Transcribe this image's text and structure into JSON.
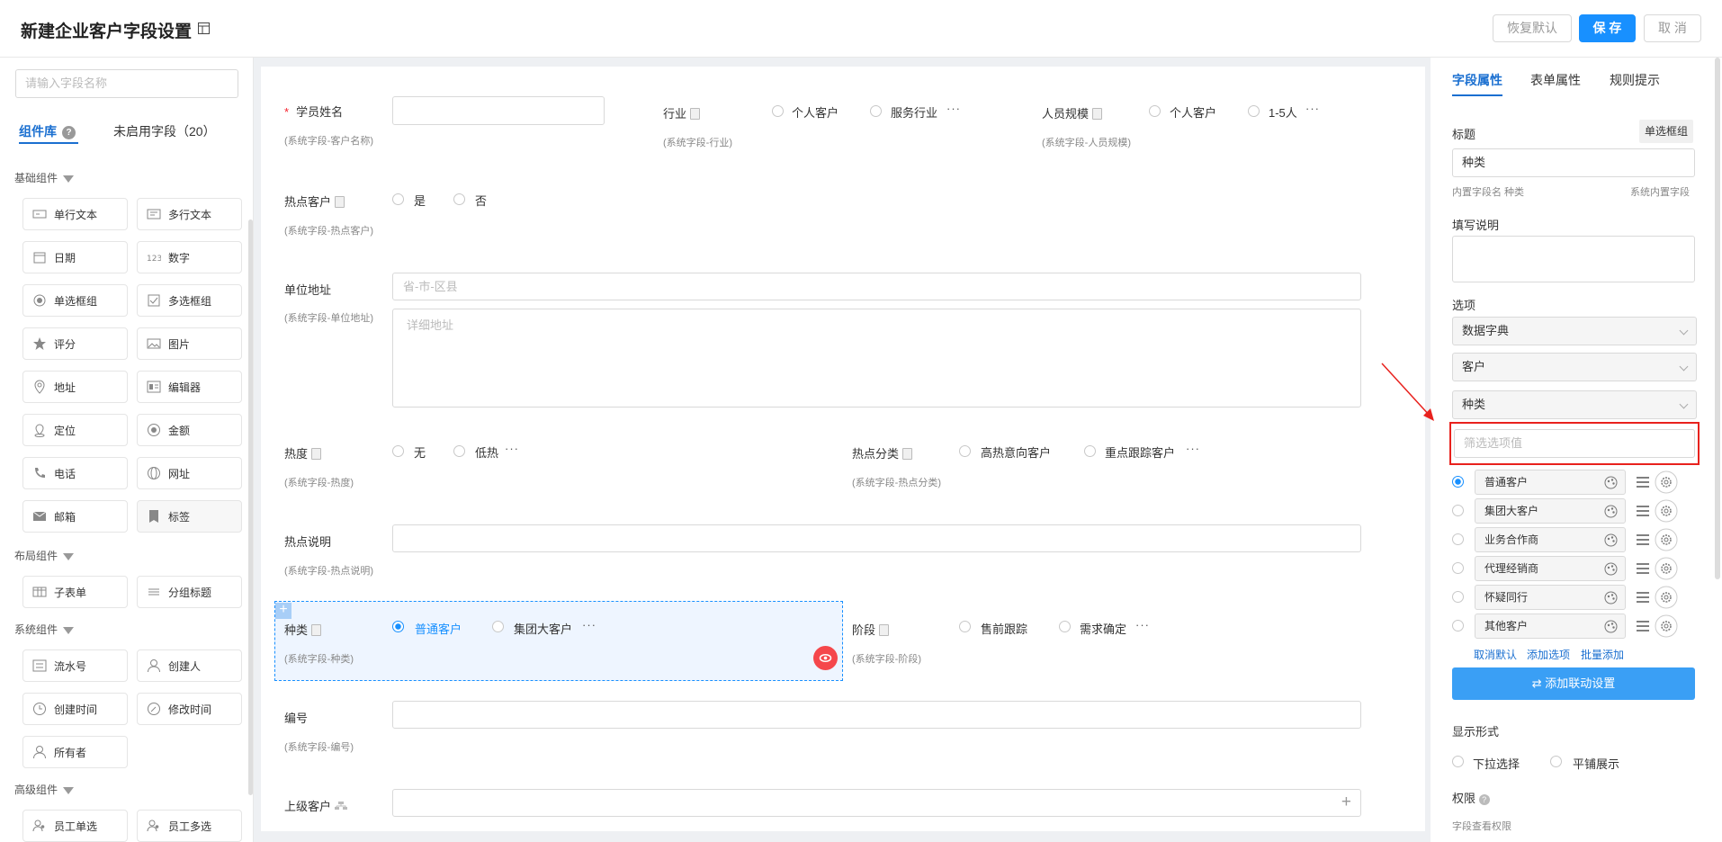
{
  "header": {
    "title": "新建企业客户字段设置",
    "restore_label": "恢复默认",
    "save_label": "保 存",
    "cancel_label": "取 消"
  },
  "left": {
    "search_placeholder": "请输入字段名称",
    "tabs": [
      {
        "label": "组件库"
      },
      {
        "label": "未启用字段（20）"
      }
    ],
    "sections": {
      "basic": "基础组件",
      "layout": "布局组件",
      "system": "系统组件",
      "advanced": "高级组件"
    },
    "basic_items": [
      "单行文本",
      "多行文本",
      "日期",
      "数字",
      "单选框组",
      "多选框组",
      "评分",
      "图片",
      "地址",
      "编辑器",
      "定位",
      "金额",
      "电话",
      "网址",
      "邮箱",
      "标签"
    ],
    "layout_items": [
      "子表单",
      "分组标题"
    ],
    "system_items": [
      "流水号",
      "创建人",
      "创建时间",
      "修改时间",
      "所有者"
    ],
    "advanced_items": [
      "员工单选",
      "员工多选"
    ]
  },
  "canvas": {
    "f1": {
      "label": "学员姓名",
      "sub": "(系统字段-客户名称)"
    },
    "f2": {
      "label": "行业",
      "sub": "(系统字段-行业)",
      "opts": [
        "个人客户",
        "服务行业"
      ]
    },
    "f3": {
      "label": "人员规模",
      "sub": "(系统字段-人员规模)",
      "opts": [
        "个人客户",
        "1-5人"
      ]
    },
    "f4": {
      "label": "热点客户",
      "sub": "(系统字段-热点客户)",
      "opts": [
        "是",
        "否"
      ]
    },
    "f5": {
      "label": "单位地址",
      "sub": "(系统字段-单位地址)",
      "ph1": "省-市-区县",
      "ph2": "详细地址"
    },
    "f6": {
      "label": "热度",
      "sub": "(系统字段-热度)",
      "opts": [
        "无",
        "低热"
      ]
    },
    "f7": {
      "label": "热点分类",
      "sub": "(系统字段-热点分类)",
      "opts": [
        "高热意向客户",
        "重点跟踪客户"
      ]
    },
    "f8": {
      "label": "热点说明",
      "sub": "(系统字段-热点说明)"
    },
    "f9": {
      "label": "种类",
      "sub": "(系统字段-种类)",
      "opts": [
        "普通客户",
        "集团大客户"
      ]
    },
    "f10": {
      "label": "阶段",
      "sub": "(系统字段-阶段)",
      "opts": [
        "售前跟踪",
        "需求确定"
      ]
    },
    "f11": {
      "label": "编号",
      "sub": "(系统字段-编号)"
    },
    "f12": {
      "label": "上级客户"
    },
    "more": "···"
  },
  "right": {
    "tabs": [
      {
        "label": "字段属性"
      },
      {
        "label": "表单属性"
      },
      {
        "label": "规则提示"
      }
    ],
    "title_label": "标题",
    "type_badge": "单选框组",
    "title_value": "种类",
    "inner_name": "内置字段名 种类",
    "sys_field": "系统内置字段",
    "desc_label": "填写说明",
    "options_label": "选项",
    "sel1": "数据字典",
    "sel2": "客户",
    "sel3": "种类",
    "filter_placeholder": "筛选选项值",
    "options": [
      "普通客户",
      "集团大客户",
      "业务合作商",
      "代理经销商",
      "怀疑同行",
      "其他客户"
    ],
    "link_cancel": "取消默认",
    "link_add": "添加选项",
    "link_batch": "批量添加",
    "linkage_btn": "添加联动设置",
    "display_label": "显示形式",
    "display_opts": [
      "下拉选择",
      "平铺展示"
    ],
    "perm_label": "权限",
    "perm_sub": "字段查看权限"
  }
}
